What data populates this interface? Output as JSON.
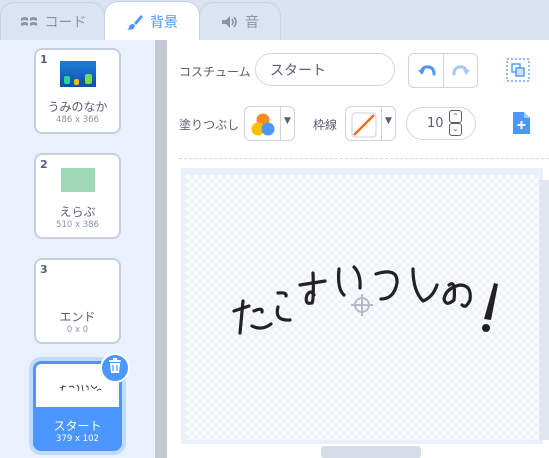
{
  "tabs": [
    {
      "label": "コード",
      "icon": "code-icon"
    },
    {
      "label": "背景",
      "icon": "brush-icon",
      "active": true
    },
    {
      "label": "音",
      "icon": "speaker-icon"
    }
  ],
  "backdrops": [
    {
      "number": "1",
      "name": "うみのなか",
      "size": "486 x 366",
      "thumbnail": "underwater-scene"
    },
    {
      "number": "2",
      "name": "えらぶ",
      "size": "510 x 386",
      "thumbnail": "green-rectangle"
    },
    {
      "number": "3",
      "name": "エンド",
      "size": "0 x 0",
      "thumbnail": "empty"
    },
    {
      "number": "4",
      "name": "スタート",
      "size": "379 x 102",
      "thumbnail": "handwritten-title",
      "selected": true
    }
  ],
  "editor": {
    "costume_label": "コスチューム",
    "costume_name": "スタート",
    "fill_label": "塗りつぶし",
    "outline_label": "枠線",
    "outline_size": "10",
    "canvas_text": "たこすいつしゅ!"
  },
  "colors": {
    "accent": "#4c97ff",
    "fill_swatch": [
      "#ff8c1a",
      "#ffbf00",
      "#4c97ff"
    ],
    "outline_slash": "#ff661a"
  }
}
